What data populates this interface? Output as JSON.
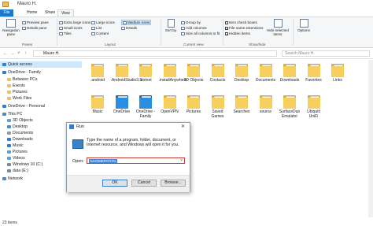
{
  "window": {
    "title": "Mauro H."
  },
  "tabs": {
    "file": "File",
    "home": "Home",
    "share": "Share",
    "view": "View"
  },
  "ribbon": {
    "navigation_pane": "Navigation pane",
    "preview_pane": "Preview pane",
    "details_pane": "Details pane",
    "extra_large_icons": "Extra large icons",
    "large_icons": "Large icons",
    "medium_icons": "Medium icons",
    "small_icons": "Small icons",
    "list": "List",
    "details": "Details",
    "tiles": "Tiles",
    "content": "Content",
    "sort_by": "Sort by",
    "group_by": "Group by",
    "add_columns": "Add columns",
    "size_all_columns": "Size all columns to fit",
    "item_check_boxes": "Item check boxes",
    "file_name_extensions": "File name extensions",
    "hidden_items": "Hidden items",
    "hide_selected_items": "Hide selected items",
    "options": "Options",
    "group_panes": "Panes",
    "group_layout": "Layout",
    "group_current_view": "Current view",
    "group_show_hide": "Show/hide"
  },
  "address": {
    "path": "Mauro H.",
    "search_placeholder": "Search Mauro H."
  },
  "nav": [
    {
      "label": "Quick access",
      "color": "#2b7fd4"
    },
    {
      "label": "OneDrive - Family",
      "color": "#2b7fd4"
    },
    {
      "label": "Between PCs",
      "color": "#e8c060"
    },
    {
      "label": "Events",
      "color": "#e8c060"
    },
    {
      "label": "Pictures",
      "color": "#e8c060"
    },
    {
      "label": "Work Files",
      "color": "#e8c060"
    },
    {
      "label": "OneDrive - Personal",
      "color": "#2b7fd4"
    },
    {
      "label": "This PC",
      "color": "#4a8ac9"
    },
    {
      "label": "3D Objects",
      "color": "#5aa0e0"
    },
    {
      "label": "Desktop",
      "color": "#3b8fd8"
    },
    {
      "label": "Documents",
      "color": "#8c9bb0"
    },
    {
      "label": "Downloads",
      "color": "#2b7fd4"
    },
    {
      "label": "Music",
      "color": "#2b7fd4"
    },
    {
      "label": "Pictures",
      "color": "#5aa0e0"
    },
    {
      "label": "Videos",
      "color": "#5aa0e0"
    },
    {
      "label": "Windows 10 (C:)",
      "color": "#7a8a9e"
    },
    {
      "label": "data (E:)",
      "color": "#7a8a9e"
    },
    {
      "label": "Network",
      "color": "#4a8ac9"
    }
  ],
  "files_row1": [
    ".android",
    ".AndroidStudio3.5",
    ".dotnet",
    ".installAnywhere",
    "3D Objects",
    "Contacts",
    "Desktop",
    "Documents",
    "Downloads",
    "Favorites",
    "Links"
  ],
  "files_row2": [
    "Music",
    "OneDrive",
    "OneDrive - Family",
    "OpenVPN",
    "Pictures",
    "Saved Games",
    "Searches",
    "source",
    "SurfaceDuo Emulator",
    "Ubiquiti UniFi"
  ],
  "status": {
    "count": "23 items"
  },
  "run": {
    "title": "Run",
    "description": "Type the name of a program, folder, document, or Internet resource, and Windows will open it for you.",
    "open_label": "Open:",
    "open_value": "%HOMEPATH%",
    "ok": "OK",
    "cancel": "Cancel",
    "browse": "Browse..."
  }
}
